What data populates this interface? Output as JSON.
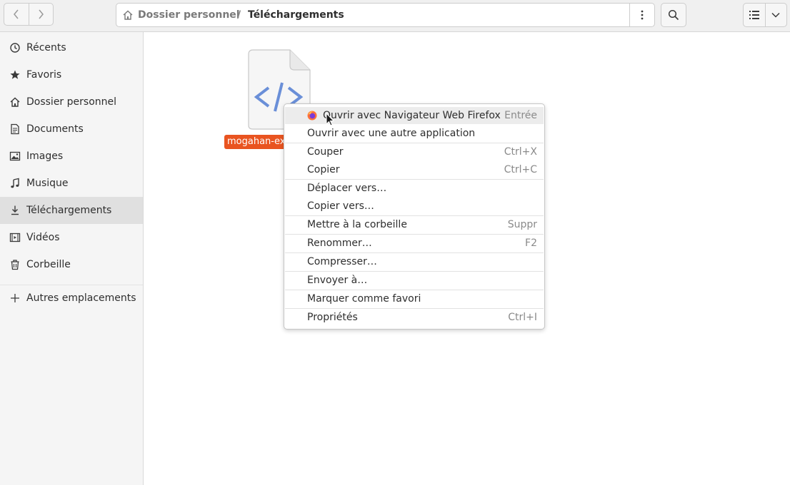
{
  "header": {
    "back_label": "back",
    "forward_label": "forward",
    "breadcrumb": {
      "home": "Dossier personnel",
      "separator": "/",
      "current": "Téléchargements"
    }
  },
  "sidebar": {
    "items": [
      {
        "label": "Récents",
        "icon": "clock-icon"
      },
      {
        "label": "Favoris",
        "icon": "star-icon"
      },
      {
        "label": "Dossier personnel",
        "icon": "home-icon"
      },
      {
        "label": "Documents",
        "icon": "document-icon"
      },
      {
        "label": "Images",
        "icon": "image-icon"
      },
      {
        "label": "Musique",
        "icon": "music-icon"
      },
      {
        "label": "Téléchargements",
        "icon": "download-icon",
        "active": true
      },
      {
        "label": "Vidéos",
        "icon": "video-icon"
      },
      {
        "label": "Corbeille",
        "icon": "trash-icon"
      },
      {
        "label": "Autres emplacements",
        "icon": "plus-icon"
      }
    ]
  },
  "file": {
    "name": "mogahan-ex",
    "icon": "html-file-icon"
  },
  "context_menu": {
    "items": [
      {
        "label": "Ouvrir avec Navigateur Web Firefox",
        "accel": "Entrée",
        "icon": "firefox-icon",
        "highlighted": true
      },
      {
        "label": "Ouvrir avec une autre application",
        "accel": ""
      },
      {
        "label": "Couper",
        "accel": "Ctrl+X"
      },
      {
        "label": "Copier",
        "accel": "Ctrl+C"
      },
      {
        "label": "Déplacer vers…",
        "accel": ""
      },
      {
        "label": "Copier vers…",
        "accel": ""
      },
      {
        "label": "Mettre à la corbeille",
        "accel": "Suppr"
      },
      {
        "label": "Renommer…",
        "accel": "F2"
      },
      {
        "label": "Compresser…",
        "accel": ""
      },
      {
        "label": "Envoyer à…",
        "accel": ""
      },
      {
        "label": "Marquer comme favori",
        "accel": ""
      },
      {
        "label": "Propriétés",
        "accel": "Ctrl+I"
      }
    ]
  },
  "colors": {
    "selection": "#e95420",
    "file_glyph": "#6a8fd8"
  }
}
